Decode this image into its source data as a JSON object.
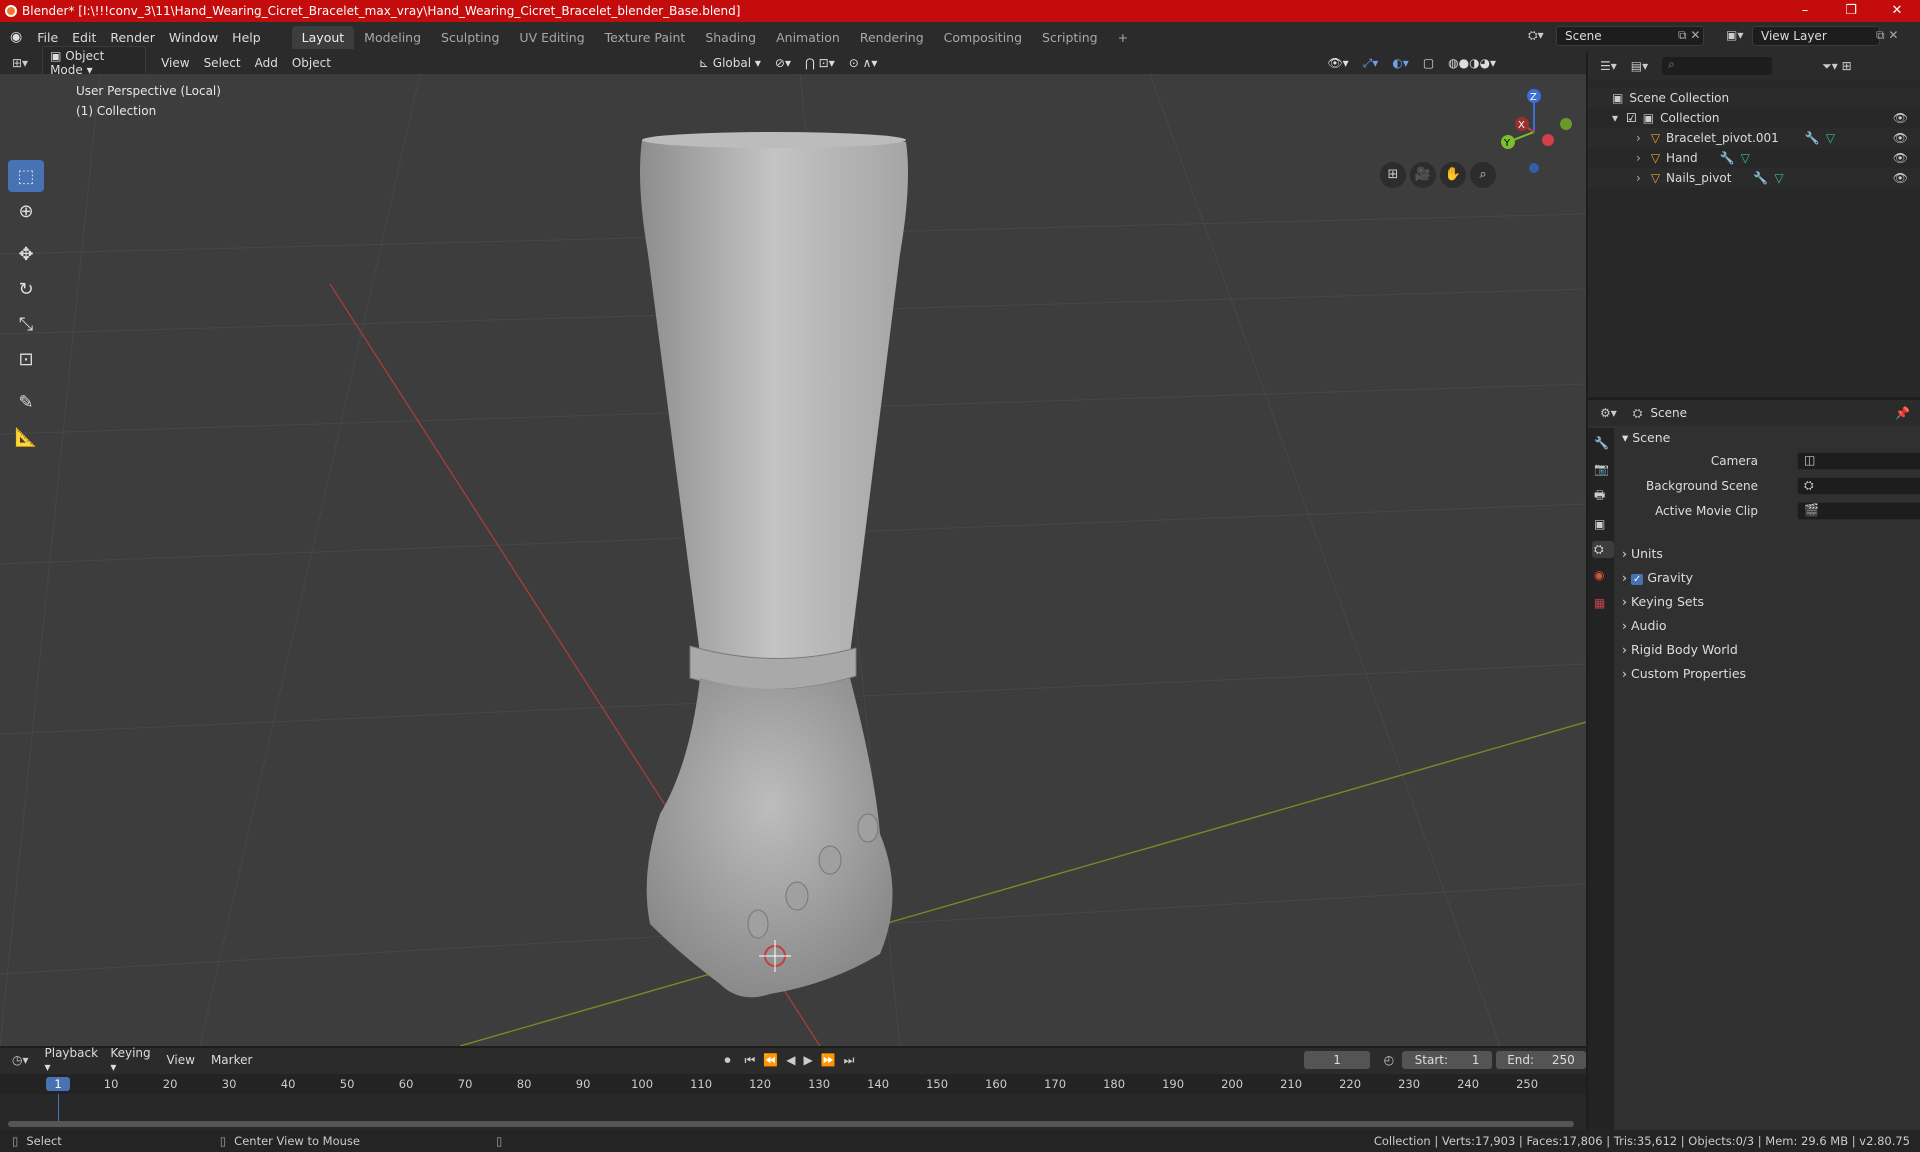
{
  "window": {
    "title": "Blender* [I:\\!!!conv_3\\11\\Hand_Wearing_Cicret_Bracelet_max_vray\\Hand_Wearing_Cicret_Bracelet_blender_Base.blend]",
    "minimize": "–",
    "maximize": "❐",
    "close": "✕"
  },
  "menu": {
    "items": [
      "File",
      "Edit",
      "Render",
      "Window",
      "Help"
    ],
    "workspaces": [
      "Layout",
      "Modeling",
      "Sculpting",
      "UV Editing",
      "Texture Paint",
      "Shading",
      "Animation",
      "Rendering",
      "Compositing",
      "Scripting"
    ],
    "add_tab": "+",
    "scene": "Scene",
    "view_layer": "View Layer"
  },
  "viewport_header": {
    "mode": "Object Mode",
    "menus": [
      "View",
      "Select",
      "Add",
      "Object"
    ],
    "transform_orientation": "Global"
  },
  "viewport": {
    "perspective": "User Perspective (Local)",
    "collection": "(1) Collection",
    "gizmo": {
      "z": "Z",
      "y": "Y",
      "x": "X"
    }
  },
  "outliner": {
    "root": "Scene Collection",
    "collection": "Collection",
    "objects": [
      "Bracelet_pivot.001",
      "Hand",
      "Nails_pivot"
    ]
  },
  "properties": {
    "header": "Scene",
    "panel": "Scene",
    "camera_label": "Camera",
    "background_label": "Background Scene",
    "movie_clip_label": "Active Movie Clip",
    "subpanels": [
      "Units",
      "Gravity",
      "Keying Sets",
      "Audio",
      "Rigid Body World",
      "Custom Properties"
    ]
  },
  "timeline": {
    "menus": [
      "Playback",
      "Keying",
      "View",
      "Marker"
    ],
    "current_frame": "1",
    "start_label": "Start:",
    "start": "1",
    "end_label": "End:",
    "end": "250",
    "ruler": [
      "1",
      "10",
      "20",
      "30",
      "40",
      "50",
      "60",
      "70",
      "80",
      "90",
      "100",
      "110",
      "120",
      "130",
      "140",
      "150",
      "160",
      "170",
      "180",
      "190",
      "200",
      "210",
      "220",
      "230",
      "240",
      "250"
    ]
  },
  "statusbar": {
    "select": "Select",
    "center": "Center View to Mouse",
    "stats": "Collection | Verts:17,903 | Faces:17,806 | Tris:35,612 | Objects:0/3 | Mem: 29.6 MB | v2.80.75"
  }
}
